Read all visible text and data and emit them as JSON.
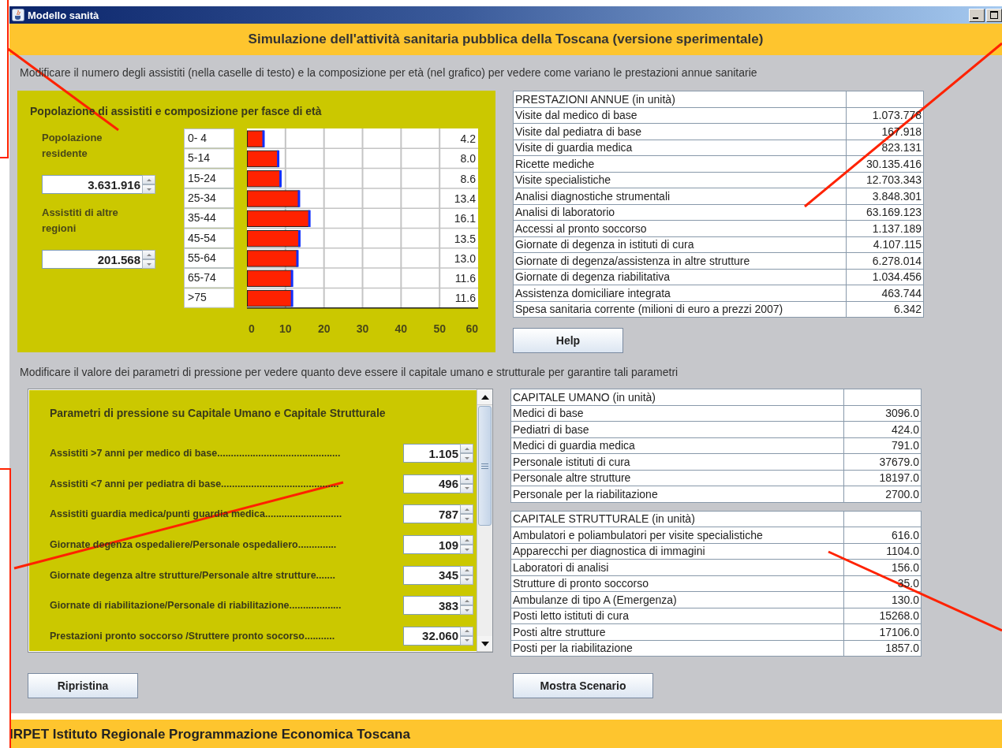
{
  "window": {
    "title": "Modello sanità"
  },
  "header": {
    "title": "Simulazione dell'attività sanitaria pubblica della Toscana (versione sperimentale)"
  },
  "instruction_top": "Modificare il numero degli assistiti (nella caselle di testo) e la composizione per età (nel grafico) per vedere come variano le prestazioni annue sanitarie",
  "population_panel": {
    "title": "Popolazione di assistiti e composizione per fasce di età",
    "fields": [
      {
        "label": "Popolazione residente",
        "value": "3.631.916"
      },
      {
        "label": "Assistiti di altre regioni",
        "value": "201.568"
      }
    ],
    "chart_data": {
      "type": "bar",
      "orientation": "horizontal",
      "categories": [
        "0-  4",
        "5-14",
        "15-24",
        "25-34",
        "35-44",
        "45-54",
        "55-64",
        "65-74",
        ">75"
      ],
      "values": [
        4.2,
        8.0,
        8.6,
        13.4,
        16.1,
        13.5,
        13.0,
        11.6,
        11.6
      ],
      "value_labels": [
        "4.2",
        "8.0",
        "8.6",
        "13.4",
        "16.1",
        "13.5",
        "13.0",
        "11.6",
        "11.6"
      ],
      "xlim": [
        0,
        60
      ],
      "xticks": [
        0,
        10,
        20,
        30,
        40,
        50,
        60
      ],
      "grid": true
    }
  },
  "services_table": {
    "title": "PRESTAZIONI ANNUE (in unità)",
    "rows": [
      {
        "label": "Visite dal medico di base",
        "value": "1.073.778"
      },
      {
        "label": "Visite dal pediatra di base",
        "value": "167.918"
      },
      {
        "label": "Visite di guardia medica",
        "value": "823.131"
      },
      {
        "label": "Ricette mediche",
        "value": "30.135.416"
      },
      {
        "label": "Visite specialistiche",
        "value": "12.703.343"
      },
      {
        "label": "Analisi diagnostiche strumentali",
        "value": "3.848.301"
      },
      {
        "label": "Analisi di laboratorio",
        "value": "63.169.123"
      },
      {
        "label": "Accessi al pronto soccorso",
        "value": "1.137.189"
      },
      {
        "label": "Giornate di degenza in istituti di cura",
        "value": "4.107.115"
      },
      {
        "label": "Giornate di degenza/assistenza in altre strutture",
        "value": "6.278.014"
      },
      {
        "label": "Giornate di degenza riabilitativa",
        "value": "1.034.456"
      },
      {
        "label": "Assistenza domiciliare integrata",
        "value": "463.744"
      },
      {
        "label": "Spesa sanitaria corrente (milioni di euro a prezzi 2007)",
        "value": "6.342"
      }
    ]
  },
  "help_button": "Help",
  "instruction_bottom": "Modificare il valore dei parametri di pressione per vedere quanto deve essere il capitale umano e strutturale per garantire tali parametri",
  "parameters_panel": {
    "title": "Parametri di pressione su Capitale Umano e Capitale Strutturale",
    "rows": [
      {
        "label": "Assistiti >7 anni per medico di base.............................................",
        "value": "1.105"
      },
      {
        "label": "Assistiti <7 anni per pediatra di base...........................................",
        "value": "496"
      },
      {
        "label": "Assistiti guardia medica/punti guardia medica............................",
        "value": "787"
      },
      {
        "label": "Giornate degenza ospedaliere/Personale ospedaliero..............",
        "value": "109"
      },
      {
        "label": "Giornate degenza altre strutture/Personale altre strutture.......",
        "value": "345"
      },
      {
        "label": "Giornate di riabilitazione/Personale di riabilitazione...................",
        "value": "383"
      },
      {
        "label": "Prestazioni pronto soccorso /Struttere pronto socorso...........",
        "value": "32.060"
      }
    ]
  },
  "human_capital_table": {
    "title": "CAPITALE UMANO (in unità)",
    "rows": [
      {
        "label": "Medici di base",
        "value": "3096.0"
      },
      {
        "label": "Pediatri di base",
        "value": "424.0"
      },
      {
        "label": "Medici di guardia medica",
        "value": "791.0"
      },
      {
        "label": "Personale istituti di cura",
        "value": "37679.0"
      },
      {
        "label": "Personale altre strutture",
        "value": "18197.0"
      },
      {
        "label": "Personale per la riabilitazione",
        "value": "2700.0"
      }
    ]
  },
  "structural_capital_table": {
    "title": "CAPITALE STRUTTURALE (in unità)",
    "rows": [
      {
        "label": "Ambulatori e poliambulatori per visite specialistiche",
        "value": "616.0"
      },
      {
        "label": "Apparecchi per diagnostica di immagini",
        "value": "1104.0"
      },
      {
        "label": "Laboratori di analisi",
        "value": "156.0"
      },
      {
        "label": "Strutture di pronto soccorso",
        "value": "35.0"
      },
      {
        "label": "Ambulanze di tipo A (Emergenza)",
        "value": "130.0"
      },
      {
        "label": "Posti letto istituti di cura",
        "value": "15268.0"
      },
      {
        "label": "Posti altre strutture",
        "value": "17106.0"
      },
      {
        "label": "Posti per la riabilitazione",
        "value": "1857.0"
      }
    ]
  },
  "buttons": [
    "Ripristina",
    "Mostra Scenario"
  ],
  "footer": "IRPET Istituto Regionale Programmazione Economica Toscana"
}
